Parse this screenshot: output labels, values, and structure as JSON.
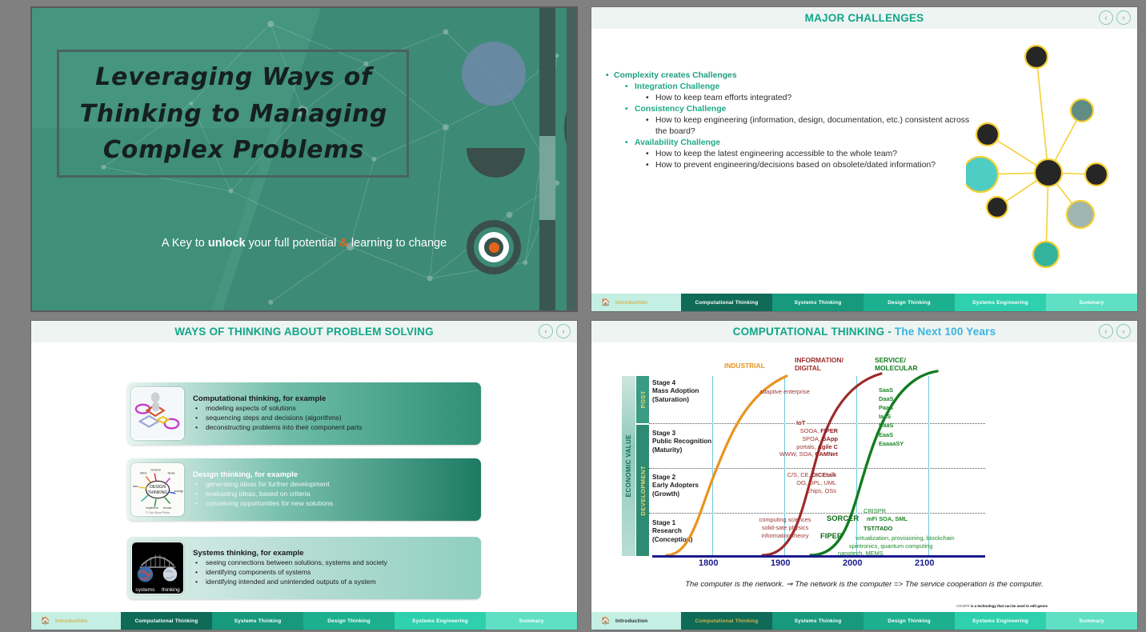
{
  "slides": {
    "title": {
      "name": "Leveraging Ways of Thinking to Managing Complex Problems",
      "line1": "Leveraging Ways of",
      "line2": "Thinking to Managing",
      "line3": "Complex Problems",
      "subtitle_a": "A Key to ",
      "subtitle_b": "unlock",
      "subtitle_c": " your full potential ",
      "subtitle_amp": "&",
      "subtitle_d": " learning to change",
      "accent_color": "#e2661a",
      "bg_color": "#3d8a77"
    },
    "challenges": {
      "title": "MAJOR CHALLENGES",
      "bullets": [
        {
          "level": 1,
          "text": "Complexity creates Challenges"
        },
        {
          "level": 2,
          "text": "Integration Challenge"
        },
        {
          "level": 3,
          "text": "How to keep team efforts integrated?"
        },
        {
          "level": 2,
          "text": "Consistency Challenge"
        },
        {
          "level": 3,
          "text": "How to keep engineering (information, design, documentation, etc.) consistent across the board?"
        },
        {
          "level": 2,
          "text": "Availability Challenge"
        },
        {
          "level": 3,
          "text": "How to keep the latest engineering accessible to the whole team?"
        },
        {
          "level": 3,
          "text": "How to prevent engineering/decisions based on obsolete/dated information?"
        }
      ],
      "graphic": "network-hub-diagram"
    },
    "ways": {
      "title": "WAYS OF THINKING ABOUT PROBLEM SOLVING",
      "cards": [
        {
          "thumb": "flowchart-figure-image",
          "heading": "Computational thinking, for example",
          "items": [
            "modeling aspects of solutions",
            "sequencing steps and decisions (algorithms)",
            "deconstructing problems into their component parts"
          ]
        },
        {
          "thumb": "design-thinking-mindmap-image",
          "thumb_credit": "© Can Stock Photo",
          "heading": "Design thinking, for example",
          "items": [
            "generating ideas for further development",
            "evaluating ideas, based on criteria",
            "conceiving opportunities for new solutions"
          ]
        },
        {
          "thumb": "systems-thinking-bridge-image",
          "thumb_caption_left": "systems",
          "thumb_caption_right": "thinking",
          "heading": "Systems thinking, for example",
          "items": [
            "seeing connections between solutions, systems and society",
            "identifying components of systems",
            "identifying intended and unintended outputs of a system"
          ]
        }
      ]
    },
    "computational": {
      "title_main": "COMPUTATIONAL THINKING - ",
      "title_sub": "The Next 100 Years",
      "caption": "The computer is the network.  ⇒  The network is the computer => The service cooperation is the computer.",
      "footnote_a": "CRISPR",
      "footnote_b": " is a technology that can be used to edit genes"
    }
  },
  "chart_data": {
    "type": "line",
    "title": "COMPUTATIONAL THINKING - The Next 100 Years",
    "xlabel": "",
    "ylabel": "ECONOMIC VALUE",
    "xticks": [
      "1800",
      "1900",
      "2000",
      "2100"
    ],
    "xlim": [
      1740,
      2160
    ],
    "ylim": [
      0,
      4
    ],
    "grid": "dotted-horizontal-stage-dividers",
    "y_axis_band_outer": "ECONOMIC VALUE",
    "y_axis_bands": [
      {
        "label": "POST",
        "color": "#3b9a82",
        "span": "Stage 4"
      },
      {
        "label": "DEVELOPMENT",
        "color": "#2e8b73",
        "span": "Stage 1-3"
      }
    ],
    "stages": [
      {
        "label": "Stage 4\nMass Adoption\n(Saturation)",
        "value": 4
      },
      {
        "label": "Stage 3\nPublic Recognition\n(Maturity)",
        "value": 3
      },
      {
        "label": "Stage 2\nEarly Adopters\n(Growth)",
        "value": 2
      },
      {
        "label": "Stage 1\nResearch\n(Conception)",
        "value": 1
      }
    ],
    "series": [
      {
        "name": "INDUSTRIAL",
        "color": "#e8941f",
        "label_color": "#e8941f",
        "points": [
          [
            1770,
            0.05
          ],
          [
            1800,
            0.6
          ],
          [
            1830,
            1.7
          ],
          [
            1860,
            2.6
          ],
          [
            1890,
            3.3
          ],
          [
            1920,
            3.8
          ],
          [
            1945,
            4.0
          ]
        ]
      },
      {
        "name": "INFORMATION/ DIGITAL",
        "color": "#9e2b2b",
        "label_color": "#9e2b2b",
        "points": [
          [
            1925,
            0.05
          ],
          [
            1945,
            0.5
          ],
          [
            1960,
            1.5
          ],
          [
            1975,
            2.6
          ],
          [
            1990,
            3.4
          ],
          [
            2010,
            3.9
          ],
          [
            2035,
            4.0
          ]
        ]
      },
      {
        "name": "SERVICE/ MOLECULAR",
        "color": "#127c1f",
        "label_color": "#127c1f",
        "points": [
          [
            1975,
            0.05
          ],
          [
            1995,
            0.6
          ],
          [
            2008,
            1.7
          ],
          [
            2020,
            2.8
          ],
          [
            2035,
            3.6
          ],
          [
            2055,
            3.95
          ],
          [
            2085,
            4.0
          ]
        ]
      }
    ],
    "annotations": [
      {
        "text": "adaptive enterprise",
        "color": "#a03636",
        "stage": 4
      },
      {
        "text": "IoT",
        "color": "#8c1d1d",
        "stage": "3/4 boundary"
      },
      {
        "text": "SOOA, FIPER",
        "color": "#a03636",
        "stage": 3
      },
      {
        "text": "SPOA, GApp",
        "color": "#a03636",
        "stage": 3
      },
      {
        "text": "portals, Agile C",
        "color": "#a03636",
        "stage": 3
      },
      {
        "text": "WWW, SOA, CAMNet",
        "color": "#a03636",
        "stage": 3
      },
      {
        "text": "C/S, CE, DICEtalk",
        "color": "#a03636",
        "stage": 2
      },
      {
        "text": "OO, DPL, UML",
        "color": "#a03636",
        "stage": 2
      },
      {
        "text": "chips, OSs",
        "color": "#a03636",
        "stage": 2
      },
      {
        "text": "computing sciences",
        "color": "#a03636",
        "stage": 1
      },
      {
        "text": "solid-sate physics",
        "color": "#a03636",
        "stage": 1
      },
      {
        "text": "information theory",
        "color": "#a03636",
        "stage": 1
      },
      {
        "text": "SaaS",
        "color": "#1f8a2b",
        "stage": 4
      },
      {
        "text": "DaaS",
        "color": "#1f8a2b",
        "stage": 4
      },
      {
        "text": "PaaS",
        "color": "#1f8a2b",
        "stage": 4
      },
      {
        "text": "IaaS",
        "color": "#1f8a2b",
        "stage": "3/4 boundary"
      },
      {
        "text": "BaaS",
        "color": "#1f8a2b",
        "stage": 3
      },
      {
        "text": "EaaS",
        "color": "#1f8a2b",
        "stage": 3
      },
      {
        "text": "EaaaaSY",
        "color": "#1f8a2b",
        "stage": 3
      },
      {
        "text": "CRISPR",
        "color": "#1f8a2b",
        "stage": 2
      },
      {
        "text": "SORCER",
        "color": "#0f6b16",
        "stage": 1
      },
      {
        "text": "mFi SOA, SML",
        "color": "#1f8a2b",
        "stage": 1
      },
      {
        "text": "TST/TADO",
        "color": "#0f6b16",
        "stage": 1
      },
      {
        "text": "FIPER",
        "color": "#0f6b16",
        "stage": 1
      },
      {
        "text": "virtualization, provisioning, blockchain",
        "color": "#1f8a2b",
        "stage": 1
      },
      {
        "text": "spintronics, quantum computing",
        "color": "#1f8a2b",
        "stage": 1
      },
      {
        "text": "nanotech, MEMS",
        "color": "#1f8a2b",
        "stage": 1
      }
    ]
  },
  "navbar": {
    "home_icon": "home-icon",
    "prev_icon": "chevron-left-icon",
    "next_icon": "chevron-right-icon",
    "tabs": [
      {
        "label": "Introduction"
      },
      {
        "label": "Computational Thinking"
      },
      {
        "label": "Systems Thinking"
      },
      {
        "label": "Design Thinking"
      },
      {
        "label": "Systems Engineering"
      },
      {
        "label": "Summary"
      }
    ]
  }
}
